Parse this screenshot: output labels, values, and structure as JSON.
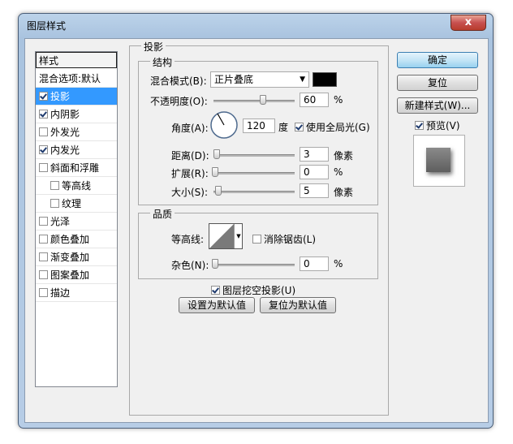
{
  "window": {
    "title": "图层样式",
    "close_label": "x"
  },
  "style_list": {
    "header": "样式",
    "items": [
      {
        "label": "混合选项:默认",
        "checkbox": false,
        "checked": false,
        "selected": false,
        "indent": false
      },
      {
        "label": "投影",
        "checkbox": true,
        "checked": true,
        "selected": true,
        "indent": false
      },
      {
        "label": "内阴影",
        "checkbox": true,
        "checked": true,
        "selected": false,
        "indent": false
      },
      {
        "label": "外发光",
        "checkbox": true,
        "checked": false,
        "selected": false,
        "indent": false
      },
      {
        "label": "内发光",
        "checkbox": true,
        "checked": true,
        "selected": false,
        "indent": false
      },
      {
        "label": "斜面和浮雕",
        "checkbox": true,
        "checked": false,
        "selected": false,
        "indent": false
      },
      {
        "label": "等高线",
        "checkbox": true,
        "checked": false,
        "selected": false,
        "indent": true
      },
      {
        "label": "纹理",
        "checkbox": true,
        "checked": false,
        "selected": false,
        "indent": true
      },
      {
        "label": "光泽",
        "checkbox": true,
        "checked": false,
        "selected": false,
        "indent": false
      },
      {
        "label": "颜色叠加",
        "checkbox": true,
        "checked": false,
        "selected": false,
        "indent": false
      },
      {
        "label": "渐变叠加",
        "checkbox": true,
        "checked": false,
        "selected": false,
        "indent": false
      },
      {
        "label": "图案叠加",
        "checkbox": true,
        "checked": false,
        "selected": false,
        "indent": false
      },
      {
        "label": "描边",
        "checkbox": true,
        "checked": false,
        "selected": false,
        "indent": false
      }
    ]
  },
  "drop_shadow": {
    "section_title": "投影",
    "structure": {
      "title": "结构",
      "blend_mode_label": "混合模式(B):",
      "blend_mode_value": "正片叠底",
      "shadow_color": "#000000",
      "opacity_label": "不透明度(O):",
      "opacity_value": "60",
      "opacity_unit": "%",
      "opacity_fraction": 0.6,
      "angle_label": "角度(A):",
      "angle_value": "120",
      "angle_unit": "度",
      "use_global_light_label": "使用全局光(G)",
      "use_global_light_checked": true,
      "distance_label": "距离(D):",
      "distance_value": "3",
      "distance_unit": "像素",
      "spread_label": "扩展(R):",
      "spread_value": "0",
      "spread_unit": "%",
      "size_label": "大小(S):",
      "size_value": "5",
      "size_unit": "像素"
    },
    "quality": {
      "title": "品质",
      "contour_label": "等高线:",
      "anti_aliased_label": "消除锯齿(L)",
      "anti_aliased_checked": false,
      "noise_label": "杂色(N):",
      "noise_value": "0",
      "noise_unit": "%"
    },
    "knockout_label": "图层挖空投影(U)",
    "knockout_checked": true,
    "make_default_label": "设置为默认值",
    "reset_default_label": "复位为默认值"
  },
  "actions": {
    "ok_label": "确定",
    "reset_label": "复位",
    "new_style_label": "新建样式(W)...",
    "preview_label": "预览(V)",
    "preview_checked": true
  },
  "colors": {
    "selection": "#3399ff",
    "window_frame": "#b7cde6"
  }
}
